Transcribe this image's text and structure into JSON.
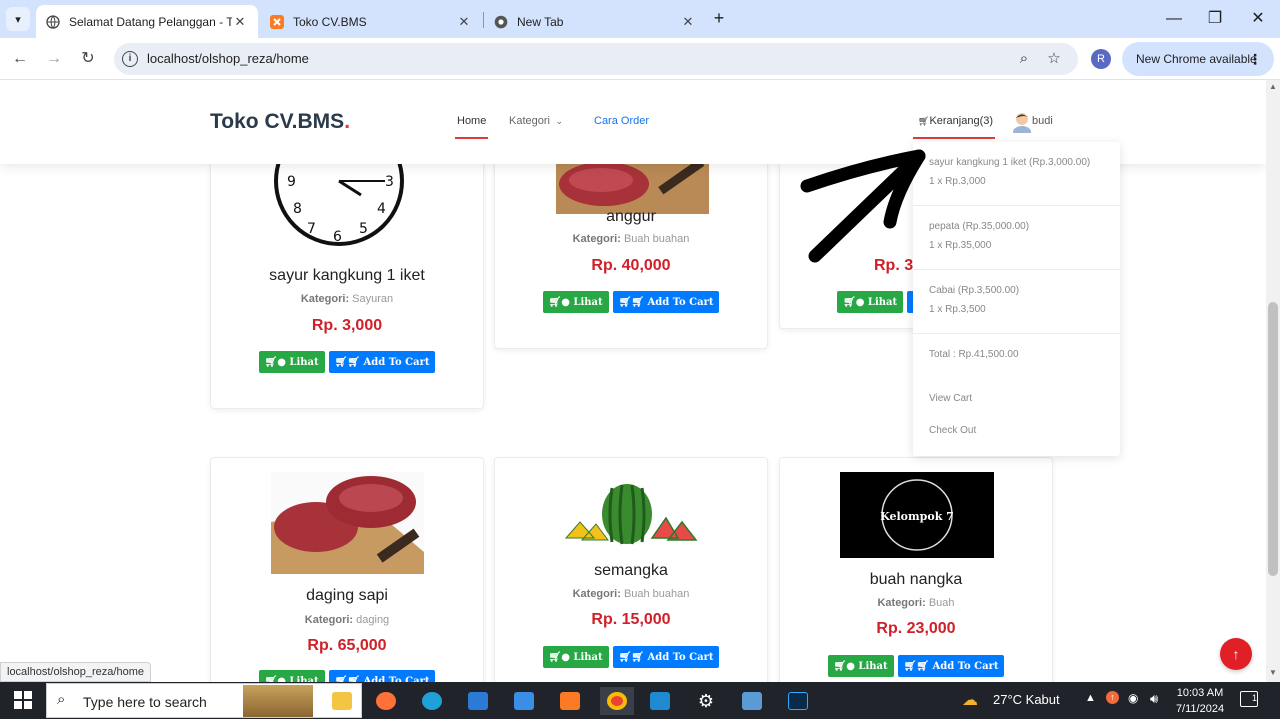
{
  "browser": {
    "tabs": [
      {
        "title": "Selamat Datang Pelanggan - To",
        "active": true
      },
      {
        "title": "Toko CV.BMS",
        "active": false
      },
      {
        "title": "New Tab",
        "active": false
      }
    ],
    "url": "localhost/olshop_reza/home",
    "profile_initial": "R",
    "update_label": "New Chrome available",
    "status_url": "localhost/olshop_reza/home"
  },
  "site": {
    "logo": "Toko CV.BMS",
    "logo_dot": ".",
    "nav": {
      "home": "Home",
      "kategori": "Kategori",
      "cara_order": "Cara Order",
      "cart": "Keranjang(3)",
      "user": "budi"
    }
  },
  "cart_dropdown": {
    "items": [
      {
        "name": "sayur kangkung 1 iket (Rp.3,000.00)",
        "qty": "1 x Rp.3,000"
      },
      {
        "name": "pepata (Rp.35,000.00)",
        "qty": "1 x Rp.35,000"
      },
      {
        "name": "Cabai (Rp.3,500.00)",
        "qty": "1 x Rp.3,500"
      }
    ],
    "total": "Total : Rp.41,500.00",
    "view_cart": "View Cart",
    "check_out": "Check Out"
  },
  "buttons": {
    "lihat": "Lihat",
    "add_to_cart": "Add To Cart"
  },
  "category_label": "Kategori:",
  "products": [
    {
      "name": "sayur kangkung 1 iket",
      "category": "Sayuran",
      "price": "Rp. 3,000"
    },
    {
      "name": "anggur",
      "category": "Buah buahan",
      "price": "Rp. 40,000"
    },
    {
      "name": "",
      "category": "",
      "price": "Rp. 3"
    },
    {
      "name": "daging sapi",
      "category": "daging",
      "price": "Rp. 65,000"
    },
    {
      "name": "semangka",
      "category": "Buah buahan",
      "price": "Rp. 15,000"
    },
    {
      "name": "buah nangka",
      "category": "Buah",
      "price": "Rp. 23,000"
    }
  ],
  "product_images": {
    "clock_numbers": [
      "9",
      "3",
      "8",
      "4",
      "7",
      "5",
      "6"
    ],
    "kelompok_label": "Kelompok 7"
  },
  "taskbar": {
    "search_placeholder": "Type here to search",
    "weather": "27°C  Kabut",
    "time": "10:03 AM",
    "date": "7/11/2024",
    "notification_count": "1"
  },
  "colors": {
    "accent_red": "#e03a3c",
    "price_red": "#d0202a",
    "btn_green": "#28a745",
    "btn_blue": "#007bff",
    "link_blue": "#1a73e8"
  }
}
